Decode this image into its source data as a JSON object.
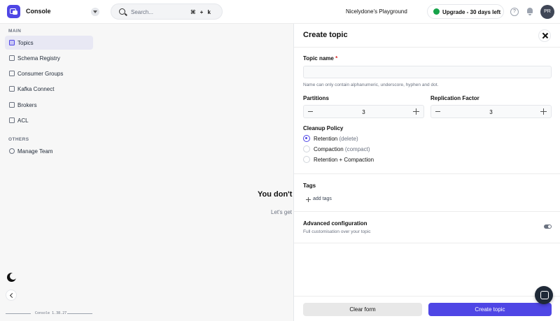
{
  "header": {
    "app_title": "Console",
    "search_placeholder": "Search...",
    "search_shortcut": "⌘ + k",
    "playground": "Nicelydone's Playground",
    "upgrade_label": "Upgrade - 30 days left",
    "avatar_initials": "PR",
    "help_glyph": "?"
  },
  "sidebar": {
    "main_label": "MAIN",
    "main_items": [
      {
        "label": "Topics",
        "icon": "topics-icon",
        "active": true
      },
      {
        "label": "Schema Registry",
        "icon": "schema-registry-icon"
      },
      {
        "label": "Consumer Groups",
        "icon": "consumer-groups-icon"
      },
      {
        "label": "Kafka Connect",
        "icon": "kafka-connect-icon"
      },
      {
        "label": "Brokers",
        "icon": "brokers-icon"
      },
      {
        "label": "ACL",
        "icon": "key-icon"
      }
    ],
    "others_label": "OTHERS",
    "other_items": [
      {
        "label": "Manage Team",
        "icon": "user-icon"
      }
    ],
    "version": "Console 1.38.27"
  },
  "main": {
    "empty_title": "You don't",
    "empty_sub": "Let's get"
  },
  "drawer": {
    "title": "Create topic",
    "topic_name_label": "Topic name",
    "required_mark": "*",
    "topic_name_value": "",
    "topic_name_hint": "Name can only contain alphanumeric, underscore, hyphen and dot.",
    "partitions_label": "Partitions",
    "partitions_value": "3",
    "replication_label": "Replication Factor",
    "replication_value": "3",
    "cleanup_label": "Cleanup Policy",
    "cleanup_options": [
      {
        "label": "Retention",
        "hint": "(delete)",
        "checked": true
      },
      {
        "label": "Compaction",
        "hint": "(compact)",
        "checked": false
      },
      {
        "label": "Retention + Compaction",
        "hint": "",
        "checked": false
      }
    ],
    "tags_label": "Tags",
    "add_tags": "add tags",
    "advanced_label": "Advanced configuration",
    "advanced_sub": "Full customisation over your topic",
    "advanced_enabled": false,
    "clear_button": "Clear form",
    "create_button": "Create topic"
  },
  "colors": {
    "accent": "#4f46e5",
    "upgrade_dot": "#16a34a"
  }
}
